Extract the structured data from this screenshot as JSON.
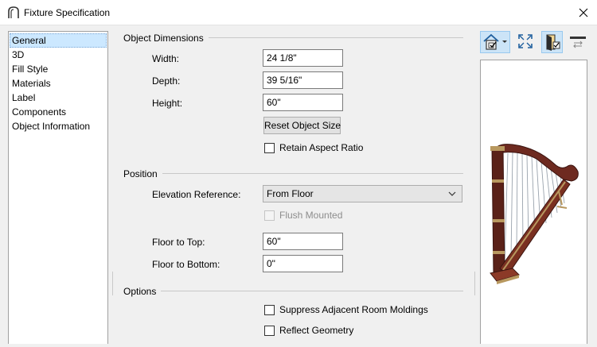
{
  "window": {
    "title": "Fixture Specification",
    "app_icon": "arch-icon",
    "close_icon": "close-icon"
  },
  "nav": {
    "items": [
      "General",
      "3D",
      "Fill Style",
      "Materials",
      "Label",
      "Components",
      "Object Information"
    ],
    "selected": "General"
  },
  "object_dimensions": {
    "title": "Object Dimensions",
    "width_label": "Width:",
    "width_value": "24 1/8\"",
    "depth_label": "Depth:",
    "depth_value": "39 5/16\"",
    "height_label": "Height:",
    "height_value": "60\"",
    "reset_button": "Reset Object Size",
    "retain_aspect_label": "Retain Aspect Ratio",
    "retain_aspect_checked": false
  },
  "position": {
    "title": "Position",
    "elevation_label": "Elevation Reference:",
    "elevation_value": "From Floor",
    "flush_label": "Flush Mounted",
    "flush_checked": false,
    "floor_top_label": "Floor to Top:",
    "floor_top_value": "60\"",
    "floor_bottom_label": "Floor to Bottom:",
    "floor_bottom_value": "0\""
  },
  "options": {
    "title": "Options",
    "suppress_label": "Suppress Adjacent Room Moldings",
    "suppress_checked": false,
    "reflect_label": "Reflect Geometry",
    "reflect_checked": false
  },
  "toolbar": {
    "icons": [
      "house-view-icon",
      "dropdown-arrow-icon",
      "fit-view-icon",
      "door-check-icon",
      "toggle-preview-icon"
    ]
  },
  "preview": {
    "object": "harp-3d-preview"
  },
  "colors": {
    "selection": "#cce8ff",
    "active_tool": "#cce4f7",
    "wood": "#6e2a20",
    "gold": "#b8985f"
  }
}
